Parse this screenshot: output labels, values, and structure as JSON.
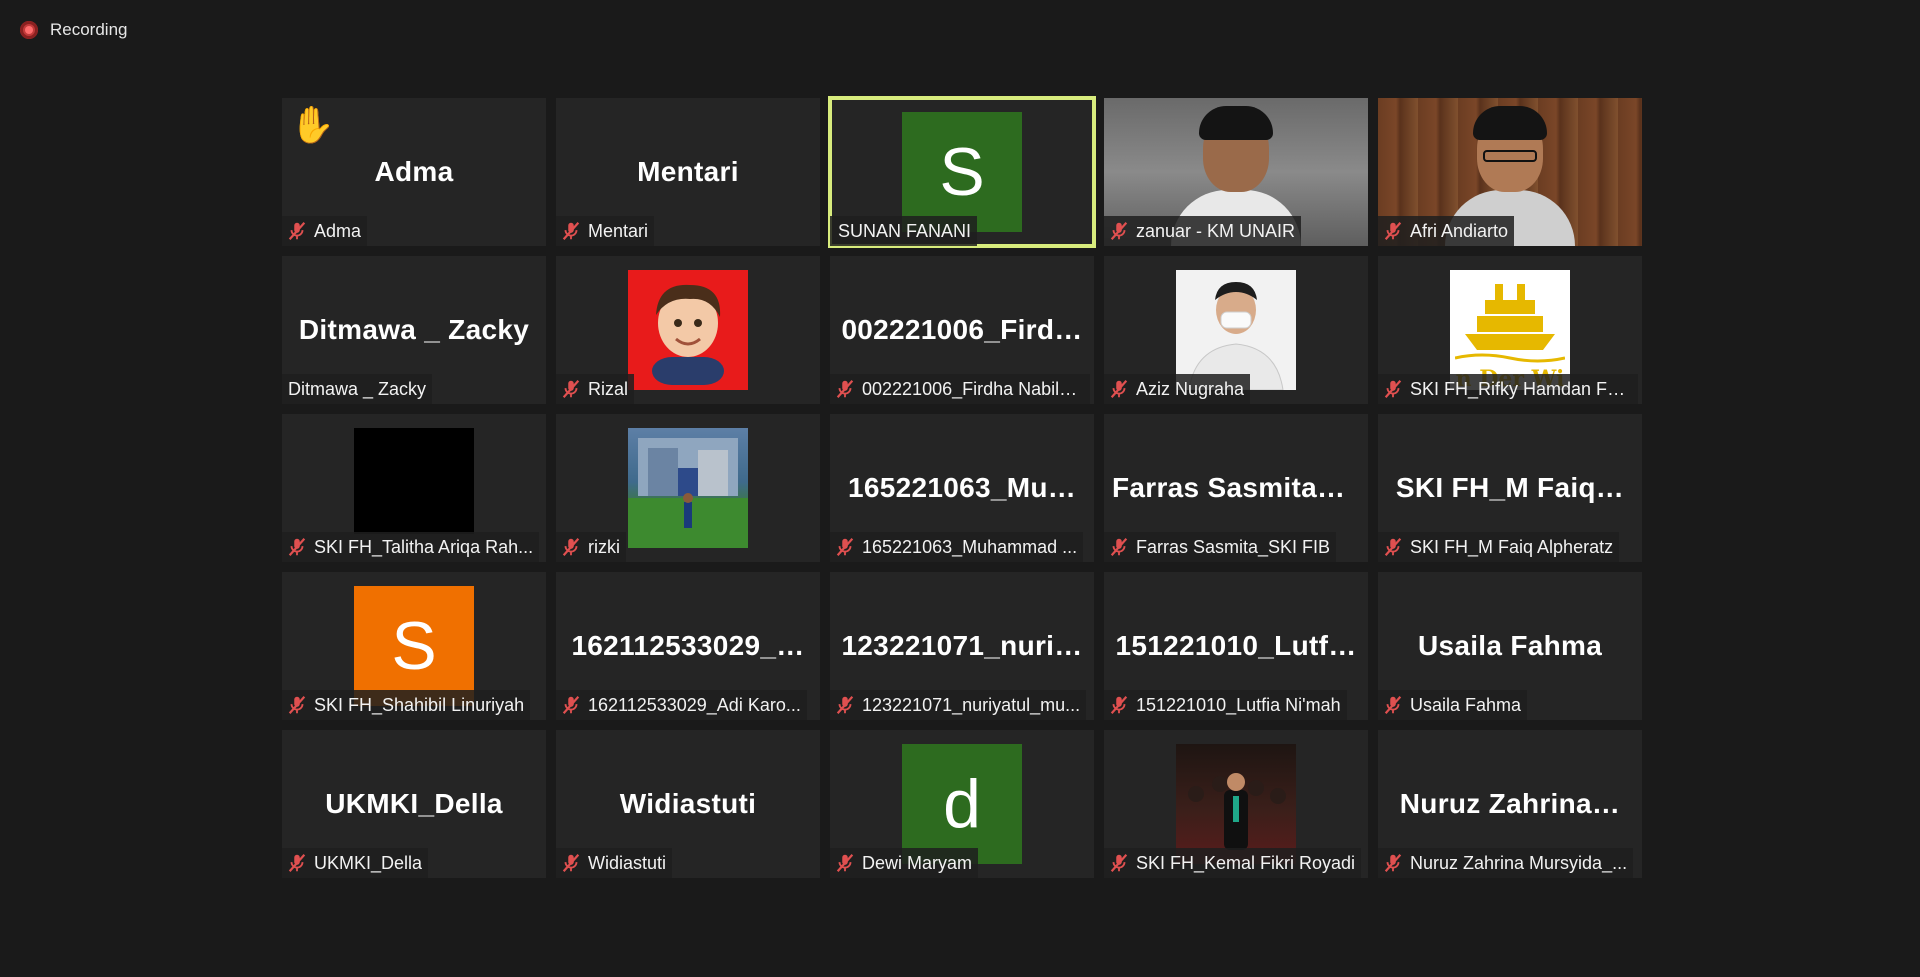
{
  "header": {
    "recording_label": "Recording"
  },
  "colors": {
    "background": "#1a1a1a",
    "tile": "#252525",
    "active_speaker_border": "#d8ec7d",
    "avatar_green": "#2d6b1f",
    "avatar_orange": "#f07000",
    "muted_icon": "#e05050"
  },
  "participants": [
    {
      "display_name": "Adma",
      "label": "Adma",
      "muted": true,
      "hand_raised": true
    },
    {
      "display_name": "Mentari",
      "label": "Mentari",
      "muted": true
    },
    {
      "label": "SUNAN FANANI",
      "avatar_letter": "S",
      "muted": false,
      "active_speaker": true
    },
    {
      "label": "zanuar - KM UNAIR",
      "muted": true,
      "video": "camera"
    },
    {
      "label": "Afri Andiarto",
      "muted": true,
      "video": "camera"
    },
    {
      "display_name": "Ditmawa _ Zacky",
      "label": "Ditmawa _ Zacky",
      "muted": false
    },
    {
      "label": "Rizal",
      "muted": true,
      "picture": "cartoon-avatar"
    },
    {
      "display_name": "002221006_Fird…",
      "label": "002221006_Firdha Nabila...",
      "muted": true
    },
    {
      "label": "Aziz Nugraha",
      "muted": true,
      "picture": "profile-photo"
    },
    {
      "label": "SKI FH_Rifky Hamdan Fat...",
      "muted": true,
      "picture": "ship-logo",
      "picture_text": "n Der Wi"
    },
    {
      "label": "SKI FH_Talitha Ariqa Rah...",
      "muted": true,
      "picture": "black"
    },
    {
      "label": "rizki",
      "muted": true,
      "picture": "outdoor-photo"
    },
    {
      "display_name": "165221063_Mu…",
      "label": "165221063_Muhammad ...",
      "muted": true
    },
    {
      "display_name": "Farras  Sasmita_…",
      "label": "Farras Sasmita_SKI FIB",
      "muted": true
    },
    {
      "display_name": "SKI  FH_M  Faiq…",
      "label": "SKI FH_M Faiq Alpheratz",
      "muted": true
    },
    {
      "label": "SKI FH_Shahibil Linuriyah",
      "avatar_letter": "S",
      "muted": true
    },
    {
      "display_name": "162112533029_…",
      "label": "162112533029_Adi Karo...",
      "muted": true
    },
    {
      "display_name": "123221071_nuri…",
      "label": "123221071_nuriyatul_mu...",
      "muted": true
    },
    {
      "display_name": "151221010_Lutf…",
      "label": "151221010_Lutfia Ni'mah",
      "muted": true
    },
    {
      "display_name": "Usaila Fahma",
      "label": "Usaila Fahma",
      "muted": true
    },
    {
      "display_name": "UKMKI_Della",
      "label": "UKMKI_Della",
      "muted": true
    },
    {
      "display_name": "Widiastuti",
      "label": "Widiastuti",
      "muted": true
    },
    {
      "label": "Dewi Maryam",
      "avatar_letter": "d",
      "muted": true
    },
    {
      "label": "SKI FH_Kemal Fikri Royadi",
      "muted": true,
      "picture": "group-photo"
    },
    {
      "display_name": "Nuruz  Zahrina…",
      "label": "Nuruz Zahrina Mursyida_...",
      "muted": true
    }
  ]
}
